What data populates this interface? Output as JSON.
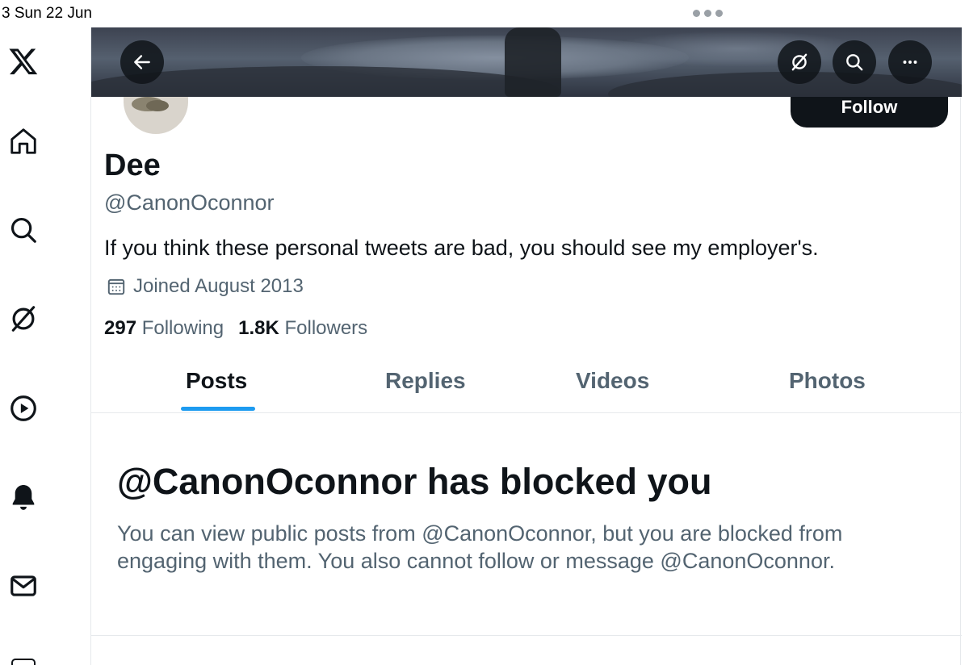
{
  "status_bar": {
    "time": "3   Sun 22 Jun"
  },
  "sidebar": {
    "items": [
      {
        "icon": "x-logo-icon"
      },
      {
        "icon": "home-icon"
      },
      {
        "icon": "search-icon"
      },
      {
        "icon": "grok-icon"
      },
      {
        "icon": "play-icon"
      },
      {
        "icon": "bell-icon"
      },
      {
        "icon": "mail-icon"
      }
    ]
  },
  "header": {
    "back_icon": "arrow-left-icon",
    "actions": [
      "grok-icon",
      "search-icon",
      "more-icon"
    ]
  },
  "profile": {
    "follow_label": "Follow",
    "display_name": "Dee",
    "handle": "@CanonOconnor",
    "bio": "If you think these personal tweets are bad, you should see my employer's.",
    "joined": "Joined August 2013",
    "following_count": "297",
    "following_label": "Following",
    "followers_count": "1.8K",
    "followers_label": "Followers"
  },
  "tabs": [
    {
      "label": "Posts",
      "active": true
    },
    {
      "label": "Replies",
      "active": false
    },
    {
      "label": "Videos",
      "active": false
    },
    {
      "label": "Photos",
      "active": false
    }
  ],
  "blocked": {
    "title": "@CanonOconnor has blocked you",
    "description": "You can view public posts from @CanonOconnor, but you are blocked from engaging with them. You also cannot follow or message @CanonOconnor."
  },
  "colors": {
    "text": "#0f1419",
    "secondary": "#536471",
    "accent": "#1d9bf0",
    "border": "#e6e9ec"
  }
}
